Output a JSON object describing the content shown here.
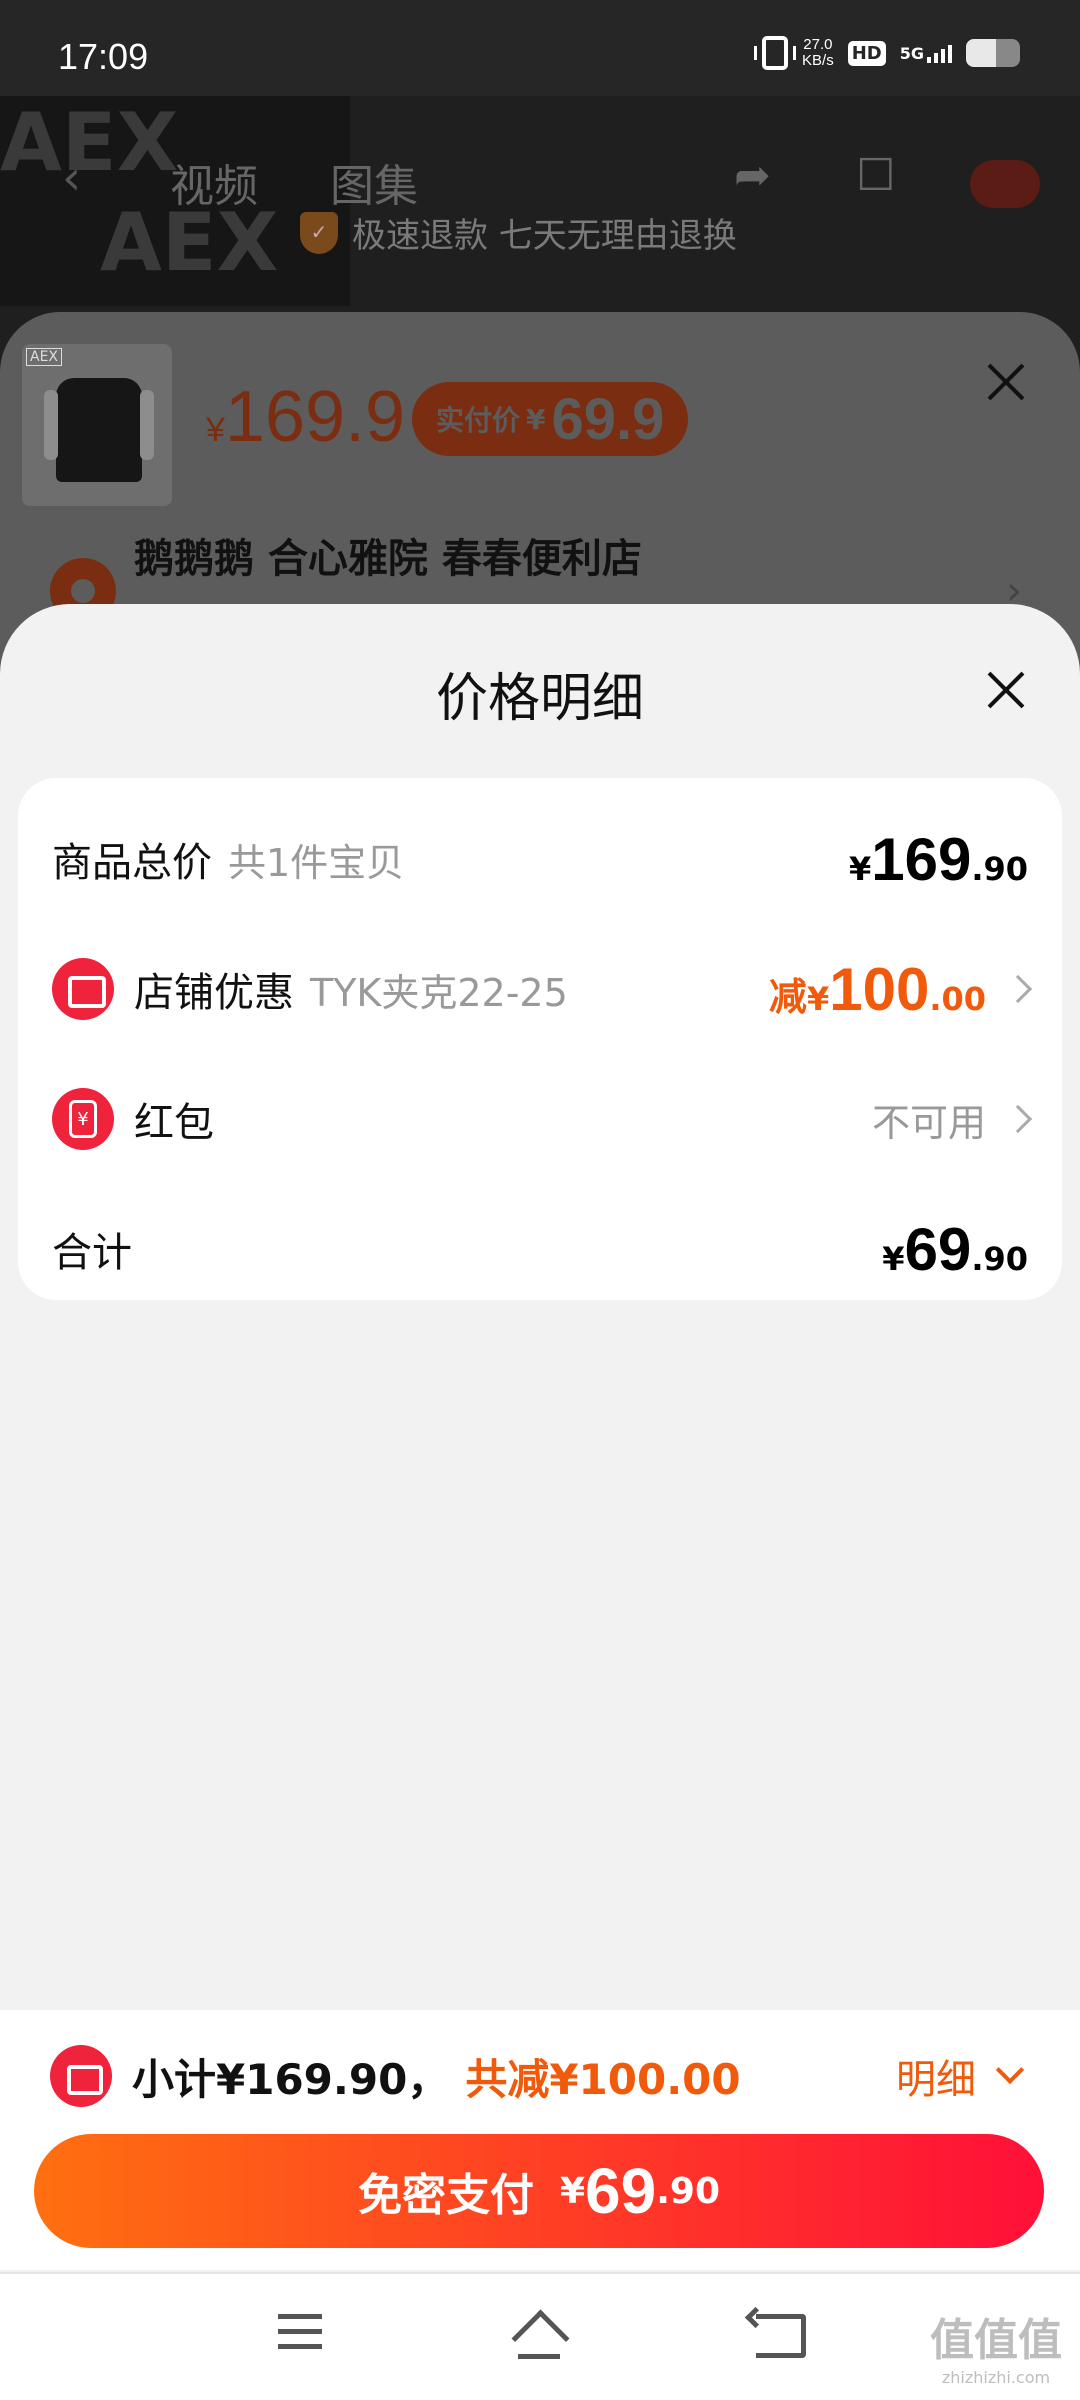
{
  "status_bar": {
    "time": "17:09",
    "speed_value": "27.0",
    "speed_unit": "KB/s",
    "hd": "HD",
    "network": "5G",
    "battery_level": 0.55
  },
  "background": {
    "tabs": [
      "视频",
      "图集"
    ],
    "guarantee_text": "极速退款 七天无理由退换",
    "thumbnail_letters": [
      "AEX",
      "AEX"
    ]
  },
  "product_sheet": {
    "brand_tag": "AEX",
    "price_currency": "¥",
    "price": "169.9",
    "actual_pay_label": "实付价",
    "actual_pay_currency": "¥",
    "actual_pay_amount": "69.9",
    "address": "鹅鹅鹅 合心雅院  春春便利店"
  },
  "price_detail": {
    "title": "价格明细",
    "rows": [
      {
        "label": "商品总价",
        "sub": "共1件宝贝",
        "currency": "¥",
        "integer": "169",
        "decimal": ".90"
      },
      {
        "label": "店铺优惠",
        "sub": "TYK夹克22-25",
        "prefix": "减",
        "currency": "¥",
        "integer": "100",
        "decimal": ".00",
        "icon": "store-icon"
      },
      {
        "label": "红包",
        "status": "不可用",
        "icon": "red-envelope-icon"
      },
      {
        "label": "合计",
        "currency": "¥",
        "integer": "69",
        "decimal": ".90"
      }
    ]
  },
  "bottom_bar": {
    "subtotal": "小计¥169.90，",
    "total_reduction": "共减¥100.00",
    "detail_label": "明细",
    "pay_label": "免密支付",
    "pay_currency": "¥",
    "pay_integer": "69",
    "pay_decimal": ".90"
  },
  "watermark": {
    "main": "值值值",
    "site": "zhizhizhi.com"
  },
  "colors": {
    "accent": "#f05a0a",
    "icon_red": "#f0233c",
    "button_start": "#ff6f10",
    "button_end": "#ff1038"
  }
}
